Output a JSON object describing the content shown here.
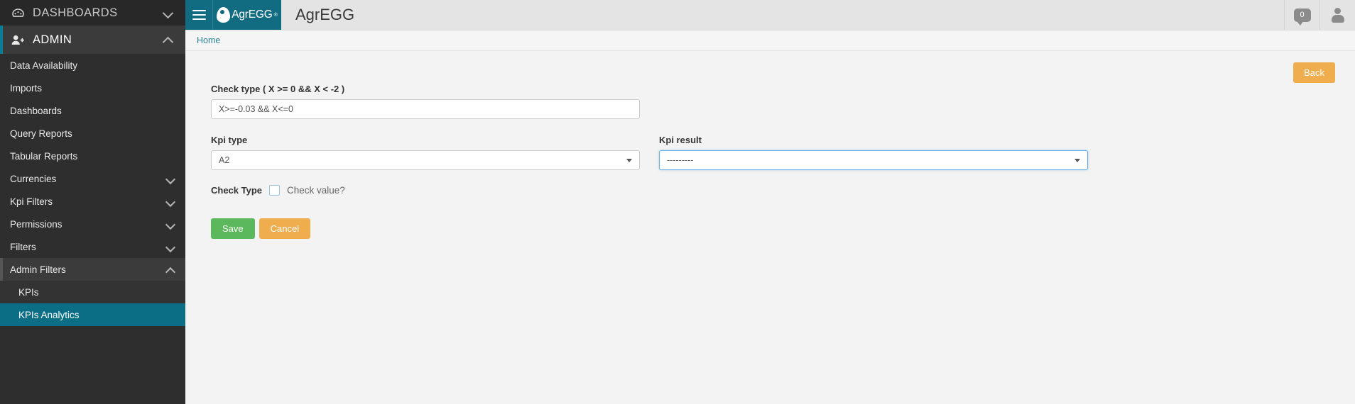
{
  "sidebar": {
    "sections": [
      {
        "label": "DASHBOARDS",
        "icon": "dashboard-icon",
        "state": "collapsed"
      },
      {
        "label": "ADMIN",
        "icon": "admin-user-icon",
        "state": "expanded"
      }
    ],
    "items": [
      {
        "label": "Data Availability",
        "expandable": false
      },
      {
        "label": "Imports",
        "expandable": false
      },
      {
        "label": "Dashboards",
        "expandable": false
      },
      {
        "label": "Query Reports",
        "expandable": false
      },
      {
        "label": "Tabular Reports",
        "expandable": false
      },
      {
        "label": "Currencies",
        "expandable": true
      },
      {
        "label": "Kpi Filters",
        "expandable": true
      },
      {
        "label": "Permissions",
        "expandable": true
      },
      {
        "label": "Filters",
        "expandable": true
      },
      {
        "label": "Admin Filters",
        "expandable": true,
        "open": true
      }
    ],
    "subitems": [
      {
        "label": "KPIs",
        "active": false
      },
      {
        "label": "KPIs Analytics",
        "active": true
      }
    ]
  },
  "header": {
    "brand_text": "AgrEGG",
    "brand_mark": "®",
    "app_title": "AgrEGG",
    "notification_count": "0"
  },
  "breadcrumb": {
    "home": "Home"
  },
  "toolbar": {
    "back_label": "Back"
  },
  "form": {
    "check_type_label": "Check type ( X >= 0 && X < -2 )",
    "check_type_value": "X>=-0.03 && X<=0",
    "kpi_type_label": "Kpi type",
    "kpi_type_value": "A2",
    "kpi_result_label": "Kpi result",
    "kpi_result_value": "---------",
    "check_type_checkbox_label": "Check Type",
    "check_value_text": "Check value?",
    "save_label": "Save",
    "cancel_label": "Cancel"
  },
  "colors": {
    "accent_teal": "#116b81",
    "active_item": "#0b6e85",
    "save_green": "#5cb85c",
    "warning_orange": "#f0ad4e",
    "focus_blue": "#66afe9"
  }
}
